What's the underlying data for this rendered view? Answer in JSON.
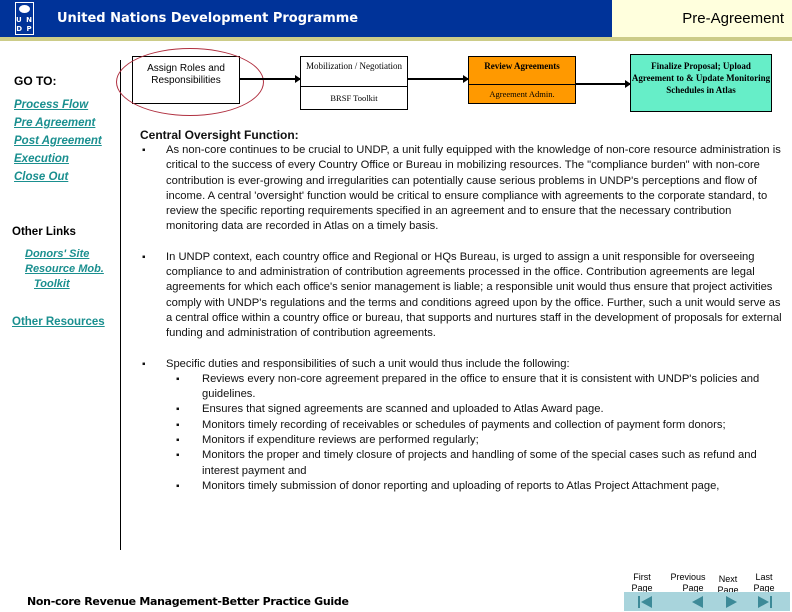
{
  "header": {
    "logo_letters": "U N D P",
    "org_name": "United Nations Development Programme",
    "page_title": "Pre-Agreement"
  },
  "sidebar": {
    "goto_label": "GO TO:",
    "goto_links": [
      "Process Flow",
      "Pre Agreement",
      "Post Agreement",
      "Execution",
      "Close Out"
    ],
    "other_links_label": "Other Links",
    "other_links": [
      "Donors' Site",
      "Resource Mob.",
      "Toolkit"
    ],
    "other_resources": "Other Resources"
  },
  "flow": {
    "assign": "Assign Roles and Responsibilities",
    "mobilization_top": "Mobilization / Negotiation",
    "mobilization_bottom": "BRSF Toolkit",
    "review_top": "Review Agreements",
    "review_bottom": "Agreement Admin.",
    "finalize": "Finalize Proposal; Upload Agreement to & Update Monitoring Schedules in Atlas",
    "colors": {
      "review": "#ff9900",
      "finalize": "#66eec8",
      "highlight_ellipse": "#b03040"
    }
  },
  "content": {
    "heading": "Central Oversight Function:",
    "paragraphs": [
      "As non-core continues to be crucial to UNDP, a unit fully equipped with the knowledge of non-core resource administration is critical to the success of every Country Office or Bureau in mobilizing resources.   The \"compliance burden\" with  non-core contribution is ever-growing and irregularities can potentially cause serious problems in UNDP's perceptions and flow of income.  A central 'oversight' function would be critical to ensure compliance with agreements to the corporate standard, to review the specific reporting requirements specified in an agreement and  to ensure that the necessary contribution monitoring data are recorded in Atlas on a timely basis.",
      "In UNDP context, each country office and Regional or HQs Bureau,  is urged to assign a unit  responsible for overseeing compliance to and administration of contribution agreements processed in the office. Contribution agreements are legal agreements for which each office's senior management is liable; a responsible unit would thus  ensure that project activities comply with UNDP's  regulations and the terms and conditions agreed upon by the office. Further,  such a unit would serve as a central office within a country office or bureau, that supports and nurtures staff in the development of proposals for external funding and administration of contribution agreements.",
      "Specific duties and responsibilities of such a unit would thus  include the following:"
    ],
    "duties": [
      "Reviews every non-core agreement prepared in  the office to ensure that it is consistent with UNDP's policies and  guidelines.",
      "Ensures that signed agreements are scanned and uploaded to Atlas Award page.",
      "Monitors timely recording of receivables or schedules of payments and collection of payment form donors;",
      "Monitors if expenditure reviews are performed regularly;",
      "Monitors the proper and timely closure of projects and handling of some of the special cases such as refund and interest payment and",
      "Monitors timely submission of donor reporting and uploading of reports to Atlas Project Attachment page,"
    ],
    "bullet": "▪"
  },
  "footer": {
    "title": "Non-core Revenue Management-Better Practice Guide",
    "nav": {
      "first": [
        "First",
        "Page"
      ],
      "previous": [
        "Previous",
        "Page"
      ],
      "next": [
        "Next",
        "Page"
      ],
      "last": [
        "Last",
        "Page"
      ]
    }
  }
}
